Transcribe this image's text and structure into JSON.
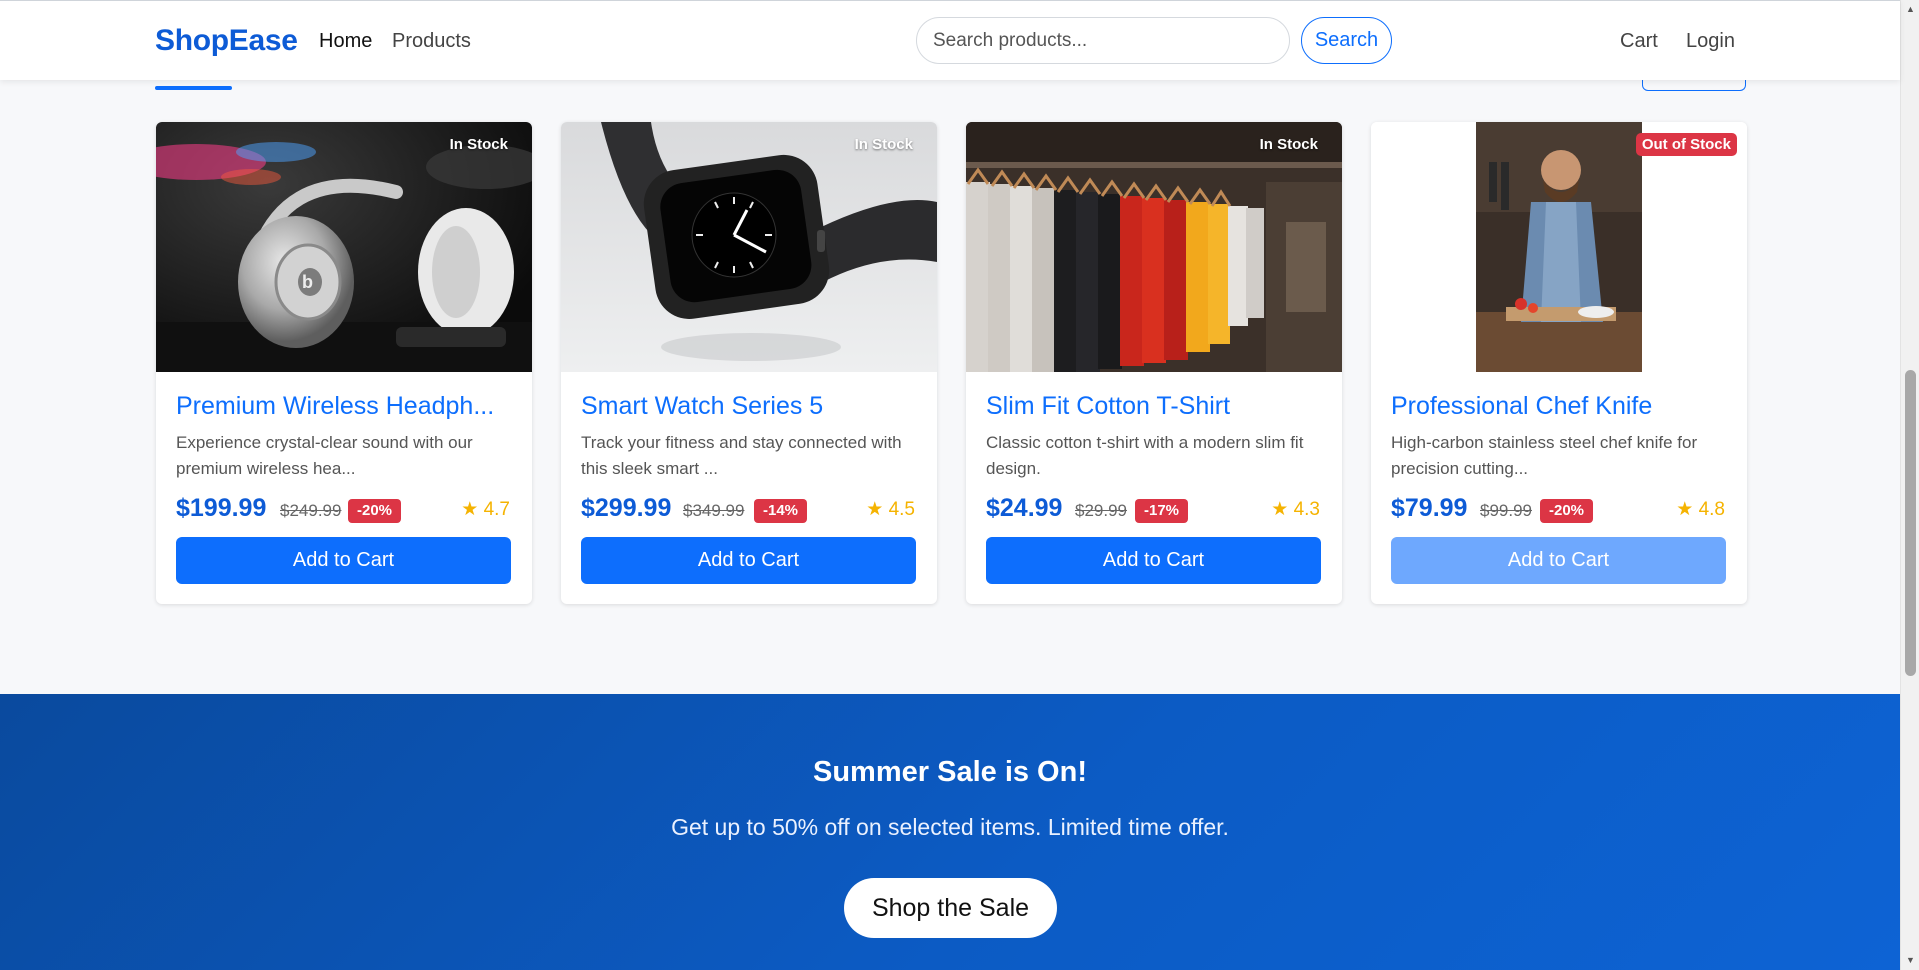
{
  "nav": {
    "brand": "ShopEase",
    "links": [
      "Home",
      "Products"
    ],
    "search_placeholder": "Search products...",
    "search_button": "Search",
    "right_links": [
      "Cart",
      "Login"
    ]
  },
  "products": [
    {
      "name": "Premium Wireless Headph...",
      "description": "Experience crystal-clear sound with our premium wireless hea...",
      "price": "$199.99",
      "old_price": "$249.99",
      "discount": "-20%",
      "rating": "★ 4.7",
      "stock": "In Stock",
      "button": "Add to Cart"
    },
    {
      "name": "Smart Watch Series 5",
      "description": "Track your fitness and stay connected with this sleek smart ...",
      "price": "$299.99",
      "old_price": "$349.99",
      "discount": "-14%",
      "rating": "★ 4.5",
      "stock": "In Stock",
      "button": "Add to Cart"
    },
    {
      "name": "Slim Fit Cotton T-Shirt",
      "description": "Classic cotton t-shirt with a modern slim fit design.",
      "price": "$24.99",
      "old_price": "$29.99",
      "discount": "-17%",
      "rating": "★ 4.3",
      "stock": "In Stock",
      "button": "Add to Cart"
    },
    {
      "name": "Professional Chef Knife",
      "description": "High-carbon stainless steel chef knife for precision cutting...",
      "price": "$79.99",
      "old_price": "$99.99",
      "discount": "-20%",
      "rating": "★ 4.8",
      "stock": "Out of Stock",
      "button": "Add to Cart"
    }
  ],
  "promo": {
    "title": "Summer Sale is On!",
    "subtitle": "Get up to 50% off on selected items. Limited time offer.",
    "button": "Shop the Sale"
  },
  "colors": {
    "primary": "#0d6efd",
    "brand": "#0d5bd6",
    "danger": "#dc3545",
    "rating": "#f5b301",
    "promo_bg": "#0c5bc4"
  }
}
